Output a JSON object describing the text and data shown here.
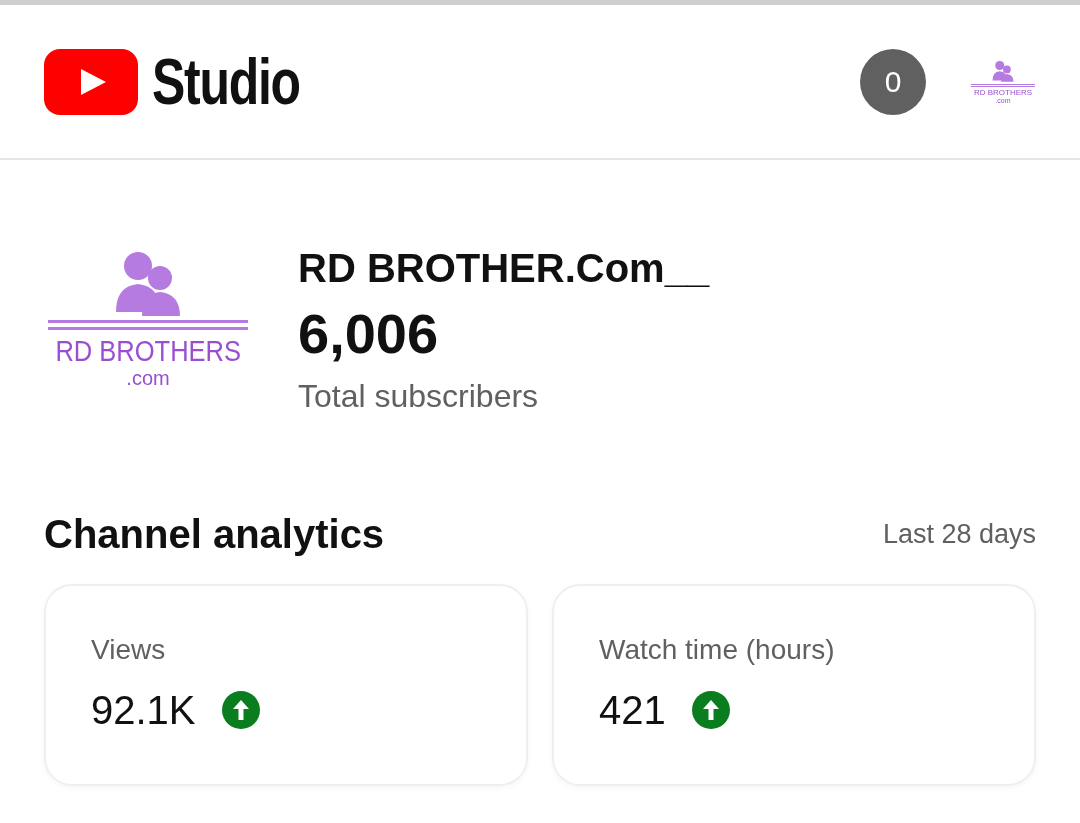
{
  "header": {
    "logo_text": "Studio",
    "notification_count": "0",
    "avatar_text": [
      "RD BROTHERS",
      ".com"
    ]
  },
  "channel": {
    "avatar_text": [
      "RD BROTHERS",
      ".com"
    ],
    "name": "RD BROTHER.Com__",
    "subscribers": "6,006",
    "subscribers_label": "Total subscribers"
  },
  "analytics": {
    "title": "Channel analytics",
    "period": "Last 28 days",
    "cards": [
      {
        "label": "Views",
        "value": "92.1K",
        "increased": true
      },
      {
        "label": "Watch time (hours)",
        "value": "421",
        "increased": true
      }
    ]
  }
}
